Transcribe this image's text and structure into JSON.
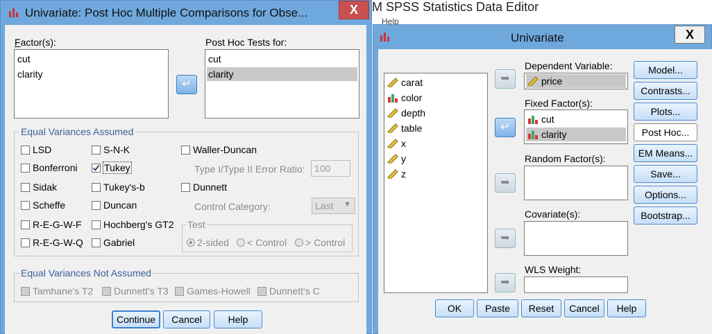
{
  "background_window": {
    "title": "M SPSS Statistics Data Editor",
    "menu_fragment": "Help"
  },
  "posthoc": {
    "title": "Univariate: Post Hoc Multiple Comparisons for Obse...",
    "close_label": "X",
    "factors_label": "Factor(s):",
    "factors": [
      "cut",
      "clarity"
    ],
    "tests_for_label": "Post Hoc Tests for:",
    "tests_for": [
      "cut",
      "clarity"
    ],
    "tests_for_selected": "clarity",
    "equal_variances_title": "Equal Variances Assumed",
    "col1": [
      "LSD",
      "Bonferroni",
      "Sidak",
      "Scheffe",
      "R-E-G-W-F",
      "R-E-G-W-Q"
    ],
    "col2": [
      "S-N-K",
      "Tukey",
      "Tukey's-b",
      "Duncan",
      "Hochberg's GT2",
      "Gabriel"
    ],
    "col2_checked": "Tukey",
    "waller_duncan": "Waller-Duncan",
    "type_error_label": "Type I/Type II Error Ratio:",
    "type_error_value": "100",
    "dunnett": "Dunnett",
    "control_category_label": "Control Category:",
    "control_category_value": "Last",
    "test_group_title": "Test",
    "test_options": [
      "2-sided",
      "< Control",
      "> Control"
    ],
    "test_selected": "2-sided",
    "not_assumed_title": "Equal Variances Not Assumed",
    "not_assumed": [
      "Tamhane's T2",
      "Dunnett's T3",
      "Games-Howell",
      "Dunnett's C"
    ],
    "buttons": {
      "continue": "Continue",
      "cancel": "Cancel",
      "help": "Help"
    }
  },
  "univariate": {
    "title": "Univariate",
    "close_label": "X",
    "variables": [
      {
        "name": "carat",
        "icon": "scale-ruler-icon"
      },
      {
        "name": "color",
        "icon": "bar-chart-icon"
      },
      {
        "name": "depth",
        "icon": "scale-ruler-icon"
      },
      {
        "name": "table",
        "icon": "scale-ruler-icon"
      },
      {
        "name": "x",
        "icon": "scale-ruler-icon"
      },
      {
        "name": "y",
        "icon": "scale-ruler-icon"
      },
      {
        "name": "z",
        "icon": "scale-ruler-icon"
      }
    ],
    "dependent_label": "Dependent Variable:",
    "dependent_value": "price",
    "fixed_label": "Fixed Factor(s):",
    "fixed_factors": [
      "cut",
      "clarity"
    ],
    "fixed_selected": "clarity",
    "random_label": "Random Factor(s):",
    "covariate_label": "Covariate(s):",
    "wls_label": "WLS Weight:",
    "side_buttons": [
      "Model...",
      "Contrasts...",
      "Plots...",
      "Post Hoc...",
      "EM Means...",
      "Save...",
      "Options...",
      "Bootstrap..."
    ],
    "bottom_buttons": {
      "ok": "OK",
      "paste": "Paste",
      "reset": "Reset",
      "cancel": "Cancel",
      "help": "Help"
    }
  }
}
